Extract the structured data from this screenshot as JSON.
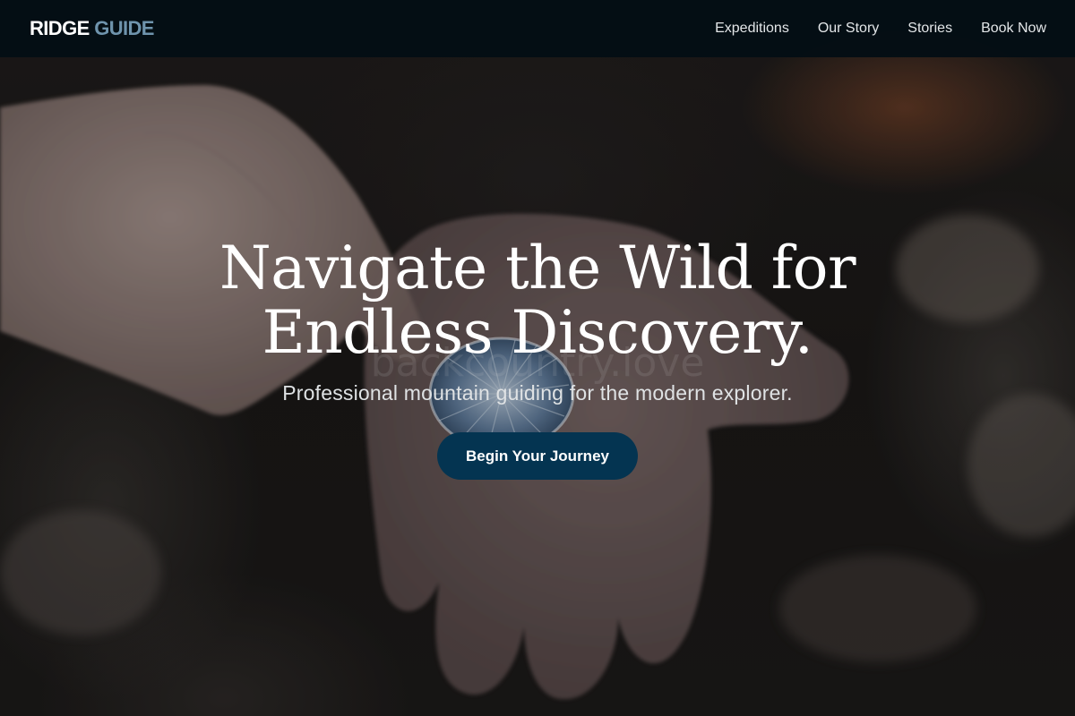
{
  "nav": {
    "logo_primary": "RIDGE",
    "logo_accent": "GUIDE",
    "links": [
      "Expeditions",
      "Our Story",
      "Stories",
      "Book Now"
    ]
  },
  "hero": {
    "title_line1": "Navigate the Wild for",
    "title_line2": "Endless Discovery.",
    "subtitle": "Professional mountain guiding for the modern explorer.",
    "cta_label": "Begin Your Journey",
    "image_watermark": "backcountry.love"
  },
  "colors": {
    "nav_background": "#030e14",
    "logo_accent": "#6f94ad",
    "cta_background": "#043451",
    "text_primary": "#ffffff"
  }
}
